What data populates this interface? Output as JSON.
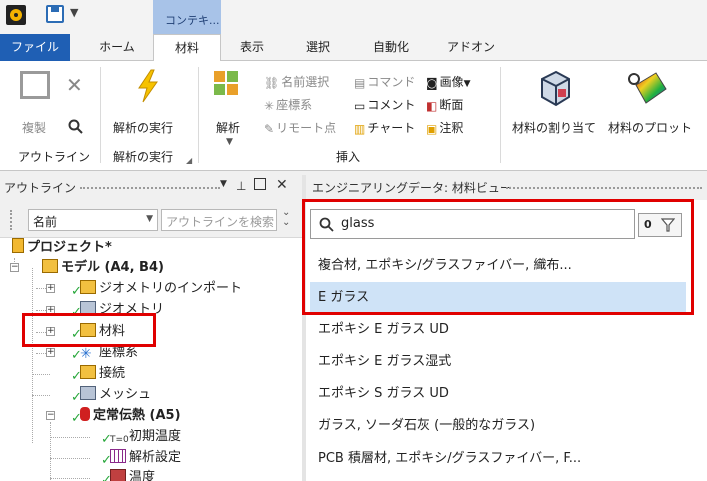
{
  "quick_access": {
    "context_tab_label": "コンテキ..."
  },
  "tabs": [
    {
      "label": "ファイル"
    },
    {
      "label": "ホーム"
    },
    {
      "label": "材料"
    },
    {
      "label": "表示"
    },
    {
      "label": "選択"
    },
    {
      "label": "自動化"
    },
    {
      "label": "アドオン"
    }
  ],
  "ribbon": {
    "outline_group": {
      "duplicate": "複製",
      "label": "アウトライン"
    },
    "solve_group": {
      "run_solve": "解析の実行",
      "label": "解析の実行"
    },
    "insert_group": {
      "analysis": "解析",
      "name_select": "名前選択",
      "command": "コマンド",
      "image": "画像",
      "coordinate_system": "座標系",
      "comment": "コメント",
      "section": "断面",
      "remote_point": "リモート点",
      "chart": "チャート",
      "annotation": "注釈",
      "label": "挿入"
    },
    "material_assignment": "材料の割り当て",
    "material_plot": "材料のプロット"
  },
  "outline": {
    "title": "アウトライン",
    "name_filter": "名前",
    "search_placeholder": "アウトラインを検索",
    "tree": [
      {
        "label": "プロジェクト*"
      },
      {
        "label": "モデル (A4, B4)"
      },
      {
        "label": "ジオメトリのインポート"
      },
      {
        "label": "ジオメトリ"
      },
      {
        "label": "材料"
      },
      {
        "label": "座標系"
      },
      {
        "label": "接続"
      },
      {
        "label": "メッシュ"
      },
      {
        "label": "定常伝熱 (A5)"
      },
      {
        "label": "初期温度"
      },
      {
        "label": "解析設定"
      },
      {
        "label": "温度"
      }
    ]
  },
  "engineering_data": {
    "title": "エンジニアリングデータ: 材料ビュー",
    "search_value": "glass",
    "filter_count": "0",
    "results": [
      "複合材, エポキシ/グラスファイバー, 織布...",
      "E ガラス",
      "エポキシ E ガラス UD",
      "エポキシ E ガラス湿式",
      "エポキシ S ガラス UD",
      "ガラス, ソーダ石灰 (一般的なガラス)",
      "PCB 積層材, エポキシ/グラスファイバー, F..."
    ],
    "selected_index": 1
  },
  "colors": {
    "file_tab": "#1f5fb4",
    "context_tab": "#a8c3e8",
    "selection": "#cfe3f7",
    "highlight_box": "#e00000",
    "check": "#27a73a"
  }
}
